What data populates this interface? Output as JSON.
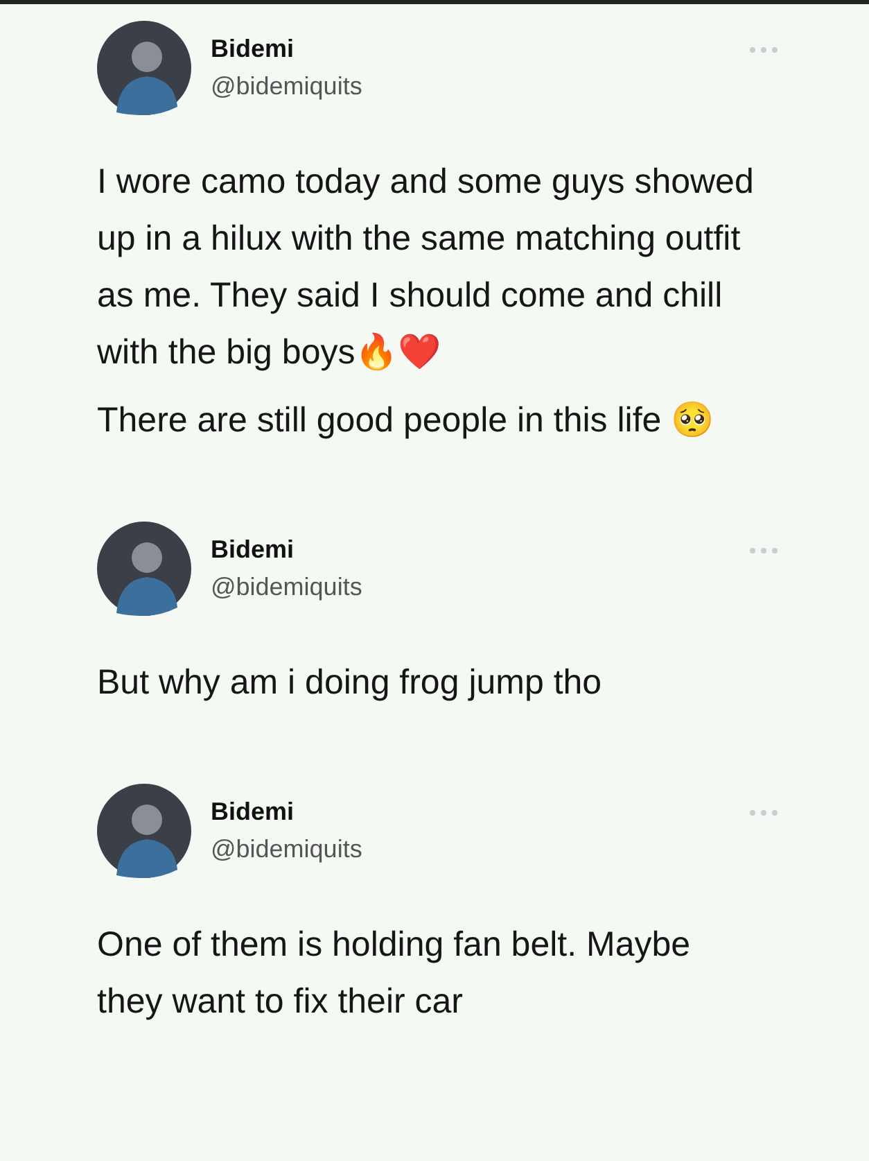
{
  "tweets": [
    {
      "name": "Bidemi",
      "handle": "@bidemiquits",
      "paragraphs": [
        "I wore camo today and some guys showed up in a hilux with the same matching outfit as me. They said I should come and chill with the big boys🔥❤️",
        "There are still good people in this life 🥺"
      ]
    },
    {
      "name": "Bidemi",
      "handle": "@bidemiquits",
      "paragraphs": [
        "But why am i doing frog jump tho"
      ]
    },
    {
      "name": "Bidemi",
      "handle": "@bidemiquits",
      "paragraphs": [
        "One of them is holding fan belt. Maybe they want to fix their car"
      ]
    }
  ]
}
